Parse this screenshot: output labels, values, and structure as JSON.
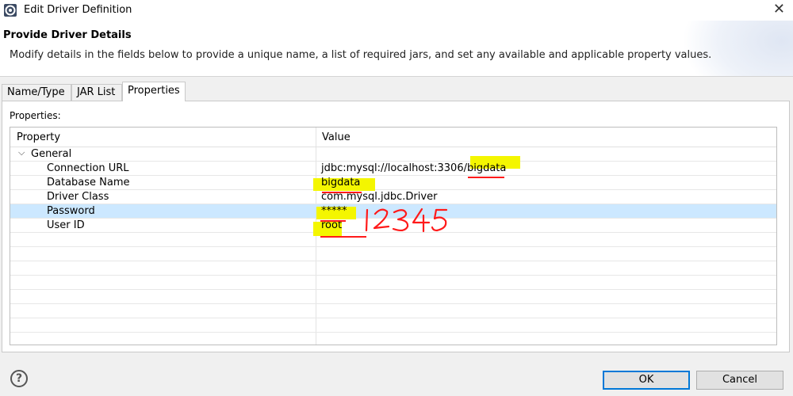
{
  "window": {
    "title": "Edit Driver Definition"
  },
  "header": {
    "title": "Provide Driver Details",
    "description": "Modify details in the fields below to provide a unique name, a list of required jars, and set any available and applicable property values."
  },
  "tabs": [
    {
      "label": "Name/Type",
      "active": false
    },
    {
      "label": "JAR List",
      "active": false
    },
    {
      "label": "Properties",
      "active": true
    }
  ],
  "properties": {
    "section_label": "Properties:",
    "columns": {
      "property": "Property",
      "value": "Value"
    },
    "group": "General",
    "rows": [
      {
        "property": "Connection URL",
        "value": "jdbc:mysql://localhost:3306/bigdata"
      },
      {
        "property": "Database Name",
        "value": "bigdata"
      },
      {
        "property": "Driver Class",
        "value": "com.mysql.jdbc.Driver"
      },
      {
        "property": "Password",
        "value": "*****",
        "selected": true
      },
      {
        "property": "User ID",
        "value": "root"
      }
    ]
  },
  "annotations": {
    "handwritten_note": "12345",
    "highlight_color": "#f4f600",
    "underline_color": "#ff1a1a"
  },
  "footer": {
    "ok_label": "OK",
    "cancel_label": "Cancel",
    "help_icon": "help-icon"
  }
}
